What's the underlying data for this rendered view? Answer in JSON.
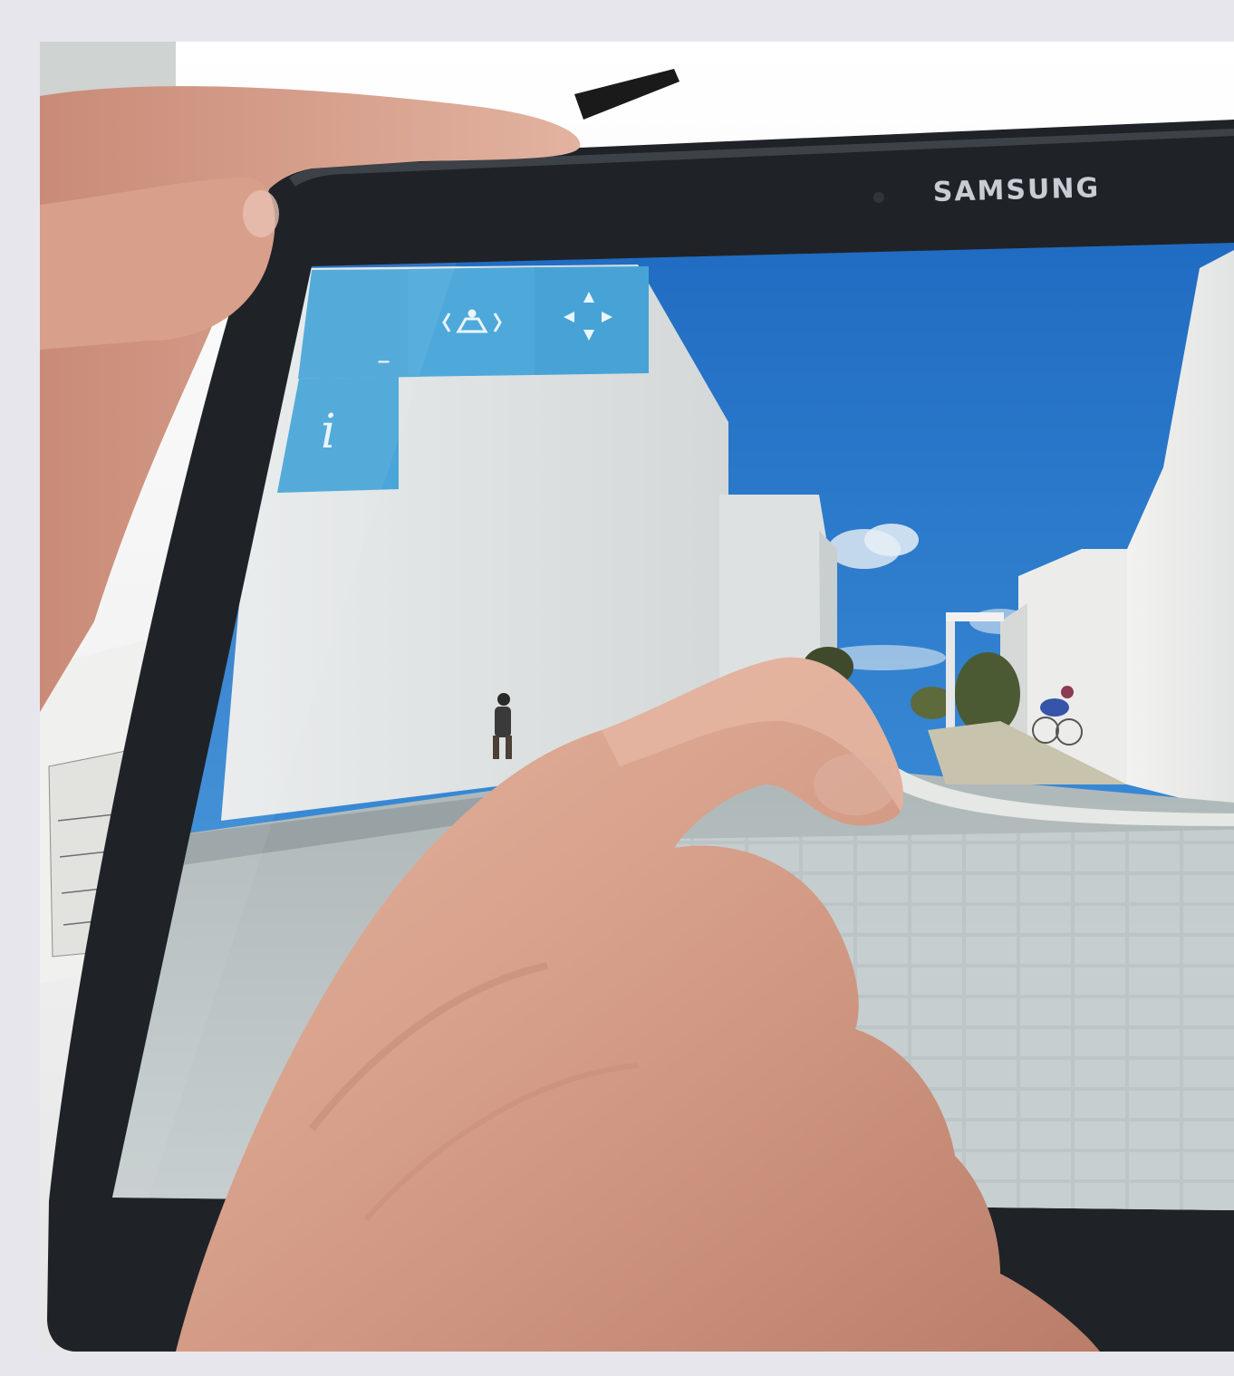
{
  "photo": {
    "description_free": true,
    "tablet": {
      "brand": "SAMSUNG"
    },
    "hud": {
      "buttons": [
        {
          "icon": "collapse-icon",
          "label": "–"
        },
        {
          "icon": "vr-goggles-icon",
          "label": ""
        },
        {
          "icon": "move-arrows-icon",
          "label": ""
        },
        {
          "icon": "info-icon",
          "label": "i"
        }
      ],
      "accent_color": "#4aa6d8"
    },
    "colors": {
      "sky": "#2a77c9",
      "bezel": "#1f2328",
      "paving": "#b9c2c4",
      "skin": "#d9a591"
    }
  }
}
